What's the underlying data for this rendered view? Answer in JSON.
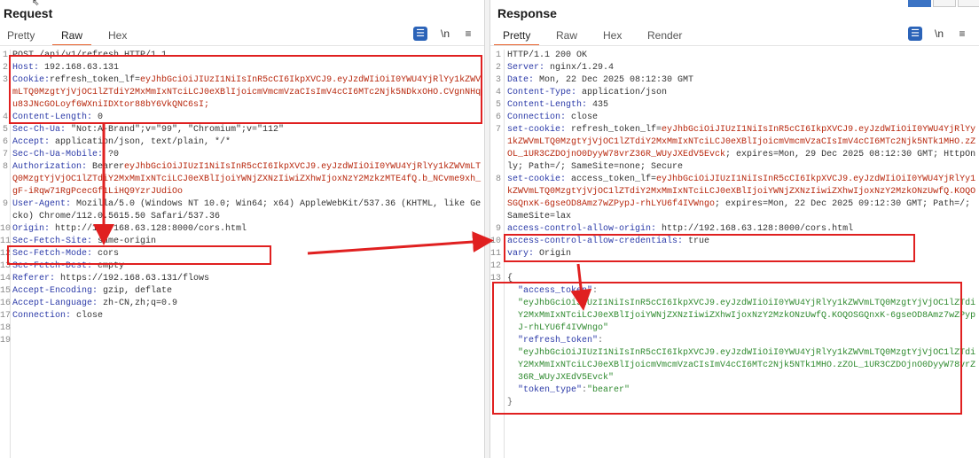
{
  "request": {
    "title": "Request",
    "tabs": [
      "Pretty",
      "Raw",
      "Hex"
    ],
    "active_tab": "Raw",
    "tools": {
      "newline": "\\n",
      "menu": "≡"
    },
    "lines": [
      {
        "n": "1",
        "text": "POST /api/v1/refresh HTTP/1.1"
      },
      {
        "n": "2",
        "name": "Host:",
        "value": " 192.168.63.131"
      },
      {
        "n": "3",
        "name": "Cookie:",
        "value": "refresh_token_lf=",
        "tok": "eyJhbGciOiJIUzI1NiIsInR5cCI6IkpXVCJ9.eyJzdWIiOiI0YWU4YjRlYy1kZWVmLTQ0MzgtYjVjOC1lZTdiY2MxMmIxNTciLCJ0eXBlIjoicmVmcmVzaCIsImV4cCI6MTc2Njk5NDkxOHO.CVgnNHqu83JNcGOLoyf6WXniIDXtor88bY6VkQNC6sI;"
      },
      {
        "n": "4",
        "name": "Content-Length:",
        "value": " 0"
      },
      {
        "n": "5",
        "name": "Sec-Ch-Ua:",
        "value": " \"Not:A-Brand\";v=\"99\", \"Chromium\";v=\"112\""
      },
      {
        "n": "6",
        "name": "Accept:",
        "value": " application/json, text/plain, */*"
      },
      {
        "n": "7",
        "name": "Sec-Ch-Ua-Mobile:",
        "value": " ?0"
      },
      {
        "n": "8",
        "name": "Authorization:",
        "value": " Bearer",
        "tok": "eyJhbGciOiJIUzI1NiIsInR5cCI6IkpXVCJ9.eyJzdWIiOiI0YWU4YjRlYy1kZWVmLTQ0MzgtYjVjOC1lZTdiY2MxMmIxNTciLCJ0eXBlIjoiYWNjZXNzIiwiZXhwIjoxNzY2MzkzMTE4fQ.b_NCvme9xh_gF-iRqw71RgPcecGf1LiHQ9YzrJUdiOo"
      },
      {
        "n": "9",
        "name": "User-Agent:",
        "value": " Mozilla/5.0 (Windows NT 10.0; Win64; x64) AppleWebKit/537.36 (KHTML, like Gecko) Chrome/112.0.5615.50 Safari/537.36"
      },
      {
        "n": "10",
        "name": "Origin:",
        "value": " http://192.168.63.128:8000/cors.html"
      },
      {
        "n": "11",
        "name": "Sec-Fetch-Site:",
        "value": " same-origin"
      },
      {
        "n": "12",
        "name": "Sec-Fetch-Mode:",
        "value": " cors"
      },
      {
        "n": "13",
        "name": "Sec-Fetch-Dest:",
        "value": " empty"
      },
      {
        "n": "14",
        "name": "Referer:",
        "value": " https://192.168.63.131/flows"
      },
      {
        "n": "15",
        "name": "Accept-Encoding:",
        "value": " gzip, deflate"
      },
      {
        "n": "16",
        "name": "Accept-Language:",
        "value": " zh-CN,zh;q=0.9"
      },
      {
        "n": "17",
        "name": "Connection:",
        "value": " close"
      },
      {
        "n": "18",
        "text": ""
      },
      {
        "n": "19",
        "text": ""
      }
    ]
  },
  "response": {
    "title": "Response",
    "tabs": [
      "Pretty",
      "Raw",
      "Hex",
      "Render"
    ],
    "active_tab": "Pretty",
    "tools": {
      "newline": "\\n",
      "menu": "≡"
    },
    "lines": [
      {
        "n": "1",
        "text": "HTTP/1.1 200 OK"
      },
      {
        "n": "2",
        "name": "Server:",
        "value": " nginx/1.29.4"
      },
      {
        "n": "3",
        "name": "Date:",
        "value": " Mon, 22 Dec 2025 08:12:30 GMT"
      },
      {
        "n": "4",
        "name": "Content-Type:",
        "value": " application/json"
      },
      {
        "n": "5",
        "name": "Content-Length:",
        "value": " 435"
      },
      {
        "n": "6",
        "name": "Connection:",
        "value": " close"
      },
      {
        "n": "7",
        "name": "set-cookie:",
        "value": " refresh_token_lf=",
        "tok": "eyJhbGciOiJIUzI1NiIsInR5cCI6IkpXVCJ9.eyJzdWIiOiI0YWU4YjRlYy1kZWVmLTQ0MzgtYjVjOC1lZTdiY2MxMmIxNTciLCJ0eXBlIjoicmVmcmVzaCIsImV4cCI6MTc2Njk5NTk1MHO.zZOL_1UR3CZDOjnO0DyyW78vrZ36R_WUyJXEdV5Evck",
        "tail": "; expires=Mon, 29 Dec 2025 08:12:30 GMT; HttpOnly; Path=/; SameSite=none; Secure"
      },
      {
        "n": "8",
        "name": "set-cookie:",
        "value": " access_token_lf=",
        "tok": "eyJhbGciOiJIUzI1NiIsInR5cCI6IkpXVCJ9.eyJzdWIiOiI0YWU4YjRlYy1kZWVmLTQ0MzgtYjVjOC1lZTdiY2MxMmIxNTciLCJ0eXBlIjoiYWNjZXNzIiwiZXhwIjoxNzY2MzkONzUwfQ.KOQOSGQnxK-6gseOD8Amz7wZPypJ-rhLYU6f4IVWngo",
        "tail": "; expires=Mon, 22 Dec 2025 09:12:30 GMT; Path=/; SameSite=lax"
      },
      {
        "n": "9",
        "name": "access-control-allow-origin:",
        "value": " http://192.168.63.128:8000/cors.html"
      },
      {
        "n": "10",
        "name": "access-control-allow-credentials:",
        "value": " true"
      },
      {
        "n": "11",
        "name": "vary:",
        "value": " Origin"
      },
      {
        "n": "12",
        "text": ""
      },
      {
        "n": "13",
        "text": "{"
      }
    ],
    "json": {
      "k1": "\"access_token\"",
      "v1": "\"eyJhbGciOiJIUzI1NiIsInR5cCI6IkpXVCJ9.eyJzdWIiOiI0YWU4YjRlYy1kZWVmLTQ0MzgtYjVjOC1lZTdiY2MxMmIxNTciLCJ0eXBlIjoiYWNjZXNzIiwiZXhwIjoxNzY2MzkONzUwfQ.KOQOSGQnxK-6gseOD8Amz7wZPypJ-rhLYU6f4IVWngo\"",
      "k2": "\"refresh_token\"",
      "v2": "\"eyJhbGciOiJIUzI1NiIsInR5cCI6IkpXVCJ9.eyJzdWIiOiI0YWU4YjRlYy1kZWVmLTQ0MzgtYjVjOC1lZTdiY2MxMmIxNTciLCJ0eXBlIjoicmVmcmVzaCIsImV4cCI6MTc2Njk5NTk1MHO.zZOL_1UR3CZDOjnO0DyyW78vrZ36R_WUyJXEdV5Evck\"",
      "k3": "\"token_type\"",
      "v3": "\"bearer\"",
      "close": "}"
    }
  },
  "colors": {
    "highlight": "#e02020",
    "accent_tab": "#e8602c"
  }
}
